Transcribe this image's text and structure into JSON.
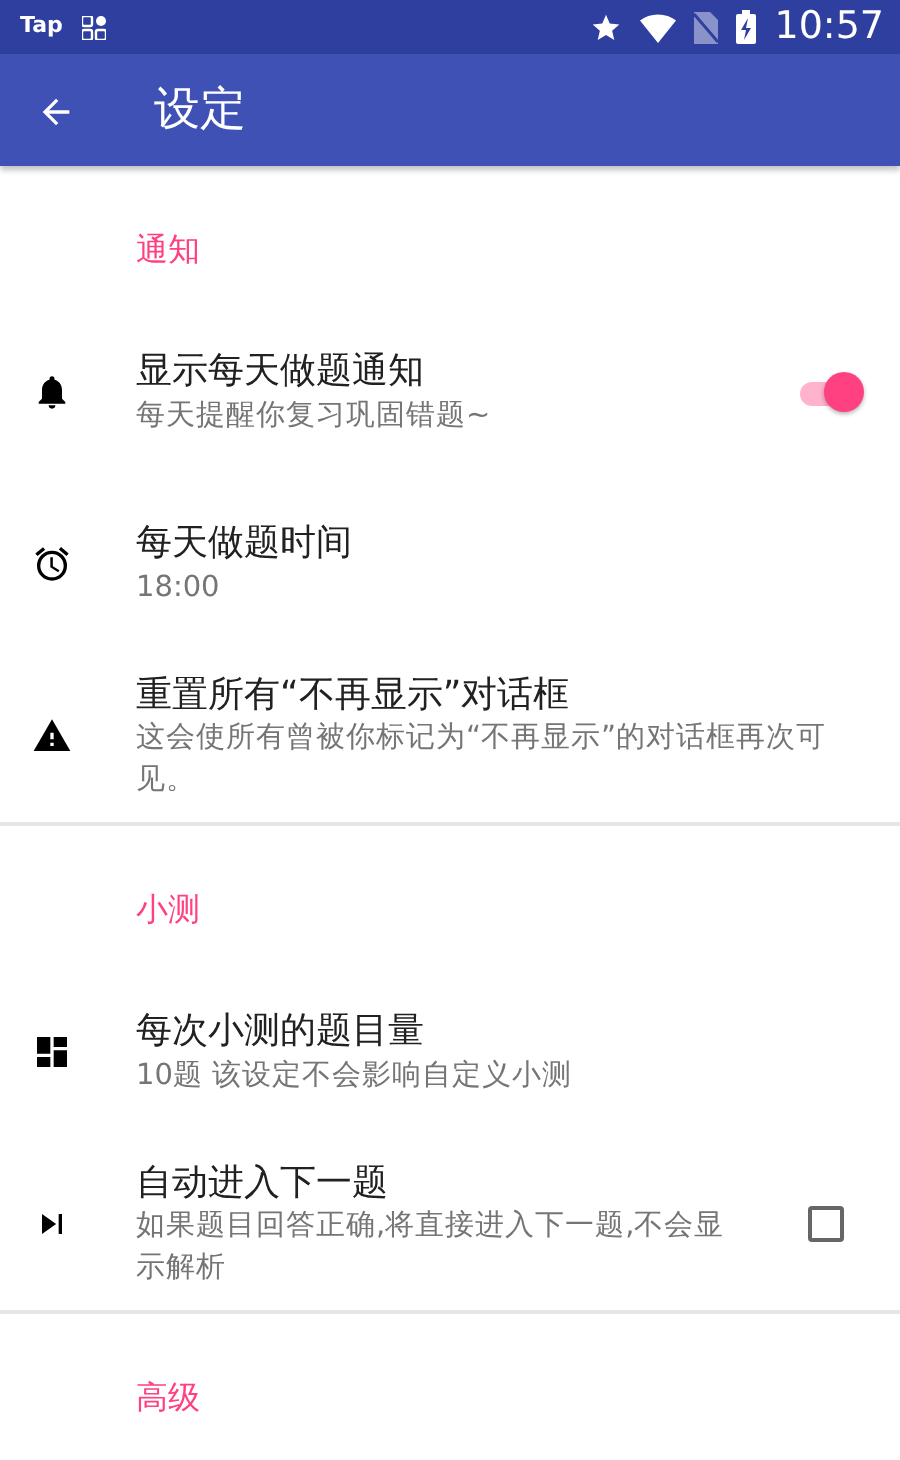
{
  "status_bar": {
    "app_label": "Tap",
    "time": "10:57"
  },
  "app_bar": {
    "title": "设定"
  },
  "sections": [
    {
      "header": "通知",
      "items": [
        {
          "title": "显示每天做题通知",
          "summary": "每天提醒你复习巩固错题~",
          "kind": "switch",
          "on": true
        },
        {
          "title": "每天做题时间",
          "summary": "18:00",
          "kind": "plain"
        },
        {
          "title": "重置所有“不再显示”对话框",
          "summary": "这会使所有曾被你标记为“不再显示”的对话框再次可见。",
          "kind": "plain"
        }
      ]
    },
    {
      "header": "小测",
      "items": [
        {
          "title": "每次小测的题目量",
          "summary": "10题 该设定不会影响自定义小测",
          "kind": "plain"
        },
        {
          "title": "自动进入下一题",
          "summary": "如果题目回答正确,将直接进入下一题,不会显示解析",
          "kind": "checkbox",
          "checked": false
        }
      ]
    },
    {
      "header": "高级"
    }
  ]
}
